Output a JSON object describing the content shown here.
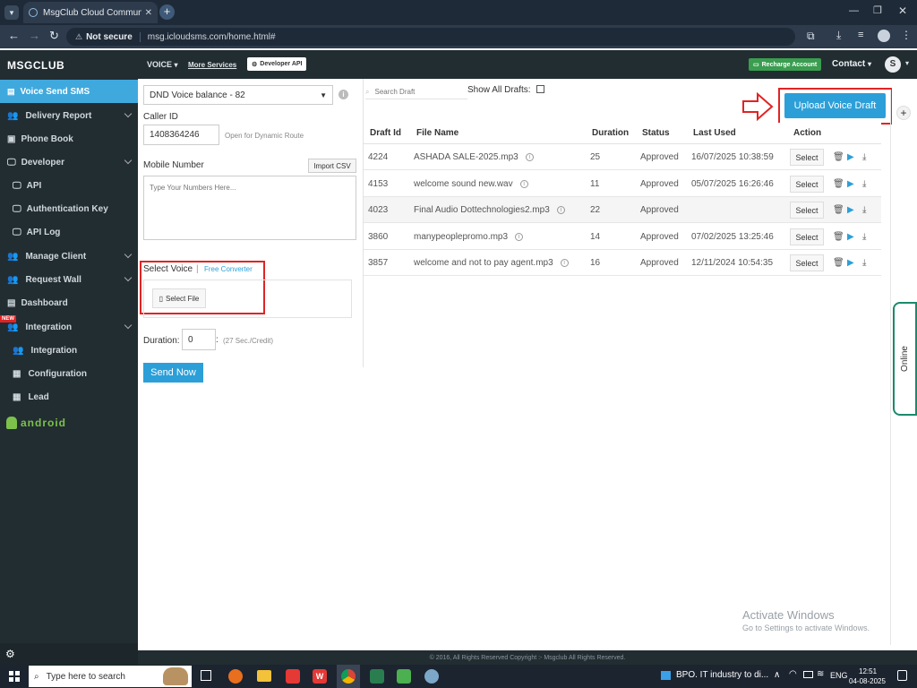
{
  "browser": {
    "tab_title": "MsgClub Cloud Communicatio",
    "not_secure": "Not secure",
    "url": "msg.icloudsms.com/home.html#"
  },
  "header": {
    "logo": "MSGCLUB",
    "voice_menu": "VOICE",
    "more_services": "More Services",
    "developer_api": "Developer API",
    "recharge": "Recharge Account",
    "contact": "Contact",
    "avatar_initial": "S"
  },
  "sidebar": {
    "items": [
      {
        "label": "Voice Send SMS"
      },
      {
        "label": "Delivery Report"
      },
      {
        "label": "Phone Book"
      },
      {
        "label": "Developer"
      },
      {
        "label": "API"
      },
      {
        "label": "Authentication Key"
      },
      {
        "label": "API Log"
      },
      {
        "label": "Manage Client"
      },
      {
        "label": "Request Wall"
      },
      {
        "label": "Dashboard"
      },
      {
        "label": "Integration"
      },
      {
        "label": "Integration"
      },
      {
        "label": "Configuration"
      },
      {
        "label": "Lead"
      }
    ],
    "new_badge": "NEW",
    "android": "android"
  },
  "form": {
    "balance_select": "DND Voice balance - 82",
    "caller_id_label": "Caller ID",
    "caller_id_value": "1408364246",
    "dynamic_route": "Open for Dynamic Route",
    "mobile_label": "Mobile Number",
    "import_csv": "Import CSV",
    "numbers_placeholder": "Type Your Numbers Here...",
    "select_voice_label": "Select Voice",
    "separator": "|",
    "free_converter": "Free Converter",
    "select_file": "Select File",
    "duration_label": "Duration:",
    "duration_value": "0",
    "colon": ":",
    "credit_note": "(27 Sec./Credit)",
    "send_now": "Send Now"
  },
  "drafts": {
    "search_placeholder": "Search Draft",
    "show_all": "Show All Drafts:",
    "upload_button": "Upload Voice Draft",
    "columns": [
      "Draft Id",
      "File Name",
      "Duration",
      "Status",
      "Last Used",
      "Action"
    ],
    "rows": [
      {
        "id": "4224",
        "file": "ASHADA SALE-2025.mp3",
        "duration": "25",
        "status": "Approved",
        "last_used": "16/07/2025 10:38:59",
        "action": "Select"
      },
      {
        "id": "4153",
        "file": "welcome sound new.wav",
        "duration": "11",
        "status": "Approved",
        "last_used": "05/07/2025 16:26:46",
        "action": "Select"
      },
      {
        "id": "4023",
        "file": "Final Audio Dottechnologies2.mp3",
        "duration": "22",
        "status": "Approved",
        "last_used": "",
        "action": "Select"
      },
      {
        "id": "3860",
        "file": "manypeoplepromo.mp3",
        "duration": "14",
        "status": "Approved",
        "last_used": "07/02/2025 13:25:46",
        "action": "Select"
      },
      {
        "id": "3857",
        "file": "welcome and not to pay agent.mp3",
        "duration": "16",
        "status": "Approved",
        "last_used": "12/11/2024 10:54:35",
        "action": "Select"
      }
    ]
  },
  "online_tab": "Online",
  "activate": {
    "title": "Activate Windows",
    "subtitle": "Go to Settings to activate Windows."
  },
  "footer": "© 2016, All Rights Reserved Copyright :- Msgclub All Rights Reserved.",
  "taskbar": {
    "search_placeholder": "Type here to search",
    "news": "BPO. IT industry to di...",
    "lang": "ENG",
    "time": "12:51",
    "date": "04-08-2025"
  },
  "colors": {
    "sidebar_bg": "#222d32",
    "active_item": "#3fa9de",
    "primary_button": "#2c9fd8",
    "highlight_red": "#e02424",
    "recharge_green": "#3a9d4f",
    "online_green": "#1b8a6b"
  }
}
